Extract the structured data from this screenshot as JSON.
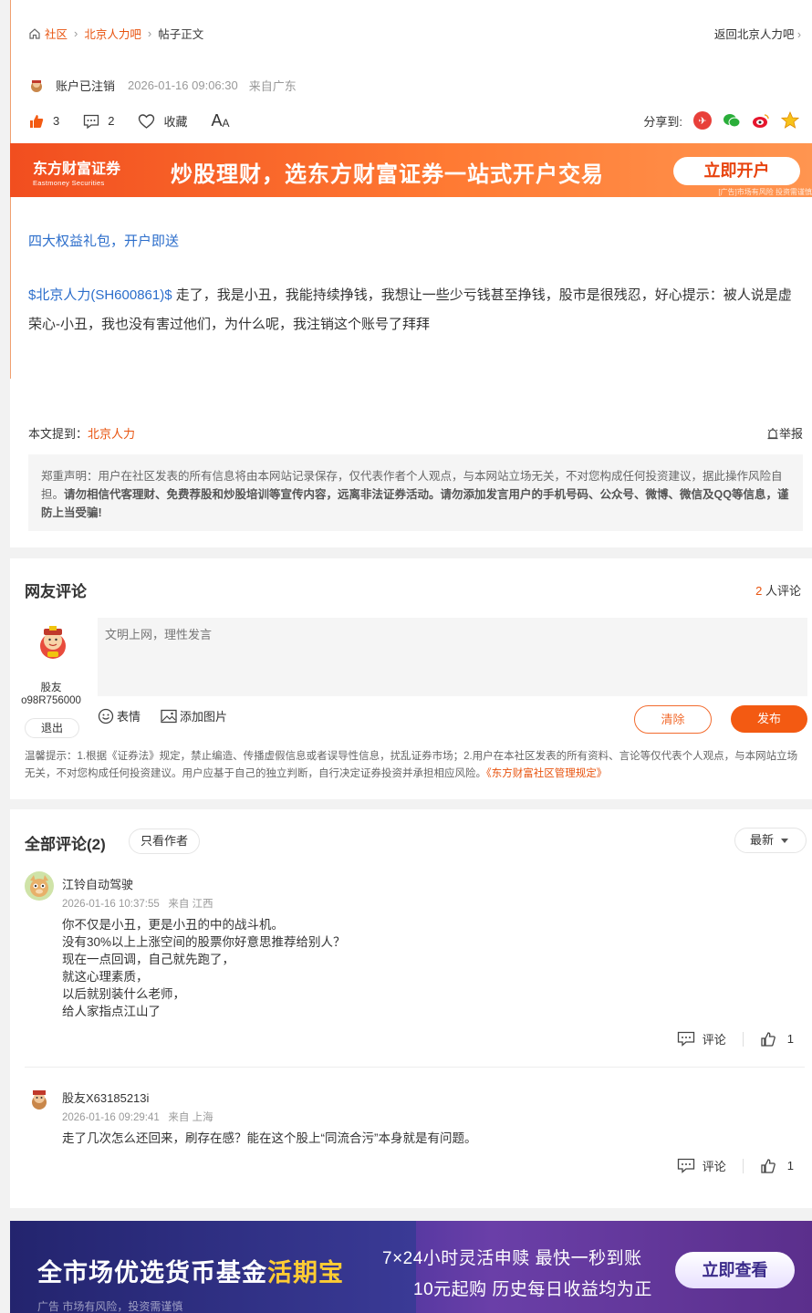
{
  "breadcrumb": {
    "home": "社区",
    "bar": "北京人力吧",
    "current": "帖子正文"
  },
  "back_link": "返回北京人力吧",
  "post": {
    "author": "账户已注销",
    "time": "2026-01-16 09:06:30",
    "from": "来自广东",
    "likes": "3",
    "comments": "2",
    "collect": "收藏",
    "font_size": "A",
    "font_size_small": "A",
    "share_label": "分享到:",
    "gift_link": "四大权益礼包，开户即送",
    "stock_tag": "$北京人力(SH600861)$",
    "body": " 走了，我是小丑，我能持续挣钱，我想让一些少亏钱甚至挣钱，股市是很残忍，好心提示：被人说是虚荣心-小丑，我也没有害过他们，为什么呢，我注销这个账号了拜拜",
    "mention_label": "本文提到：",
    "mention_stock": "北京人力",
    "report": "举报",
    "disclaimer_normal": "郑重声明：用户在社区发表的所有信息将由本网站记录保存，仅代表作者个人观点，与本网站立场无关，不对您构成任何投资建议，据此操作风险自担。",
    "disclaimer_bold": "请勿相信代客理财、免费荐股和炒股培训等宣传内容，远离非法证券活动。请勿添加发言用户的手机号码、公众号、微博、微信及QQ等信息，谨防上当受骗!"
  },
  "ad_top": {
    "logo": "东方财富证券",
    "logo_en": "Eastmoney Securities",
    "slogan": "炒股理财，选东方财富证券一站式开户交易",
    "button": "立即开户",
    "tag": "[广告]市场有风险 投资需谨慎"
  },
  "comment_box": {
    "title": "网友评论",
    "count_num": "2",
    "count_text": " 人评论",
    "user_name": "股友o98R756000",
    "logout": "退出",
    "placeholder": "文明上网，理性发言",
    "emoji": "表情",
    "add_image": "添加图片",
    "clear": "清除",
    "publish": "发布",
    "tip": "温馨提示：1.根据《证券法》规定，禁止编造、传播虚假信息或者误导性信息，扰乱证券市场；2.用户在本社区发表的所有资料、言论等仅代表个人观点，与本网站立场无关，不对您构成任何投资建议。用户应基于自己的独立判断，自行决定证券投资并承担相应风险。",
    "tip_link": "《东方财富社区管理规定》"
  },
  "comment_list": {
    "title": "全部评论(2)",
    "only_author": "只看作者",
    "sort": "最新",
    "items": [
      {
        "name": "江铃自动驾驶",
        "time": "2026-01-16 10:37:55",
        "from": "来自 江西",
        "text": "你不仅是小丑，更是小丑的中的战斗机。\n没有30%以上上涨空间的股票你好意思推荐给别人？\n现在一点回调，自己就先跑了，\n就这心理素质，\n以后就别装什么老师，\n给人家指点江山了",
        "reply": "评论",
        "likes": "1"
      },
      {
        "name": "股友X63185213i",
        "time": "2026-01-16 09:29:41",
        "from": "来自 上海",
        "text": "走了几次怎么还回来，刷存在感？能在这个股上“同流合污”本身就是有问题。",
        "reply": "评论",
        "likes": "1"
      }
    ]
  },
  "ad_bottom": {
    "big": "全市场优选货币基金",
    "highlight": "活期宝",
    "line1": "7×24小时灵活申赎  最快一秒到账",
    "line2": "10元起购  历史每日收益均为正",
    "button": "立即查看",
    "tag": "广告 市场有风险，投资需谨慎"
  },
  "colors": {
    "accent": "#f35a12",
    "link": "#2c6ecb"
  }
}
